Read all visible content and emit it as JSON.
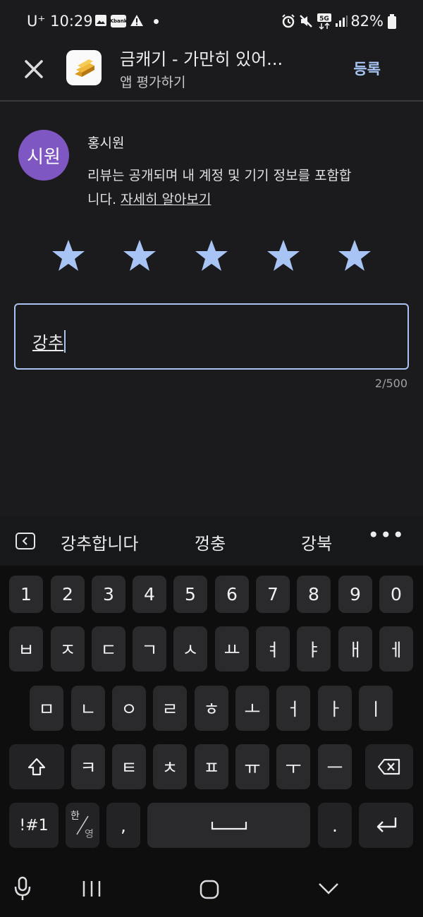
{
  "status": {
    "carrier": "U⁺ 10:29",
    "battery": "82%",
    "icons": [
      "gallery-icon",
      "kbank-icon",
      "warning-icon",
      "dot-icon",
      "alarm-icon",
      "mute-icon",
      "5g-icon",
      "signal-icon",
      "battery-icon"
    ],
    "kbank_label": "Kbank"
  },
  "header": {
    "app_title": "금캐기 - 가만히 있어...",
    "subtitle": "앱 평가하기",
    "post_label": "등록"
  },
  "user": {
    "avatar_text": "시원",
    "avatar_color": "#7e57c2",
    "name": "홍시원",
    "notice": "리뷰는 공개되며 내 계정 및 기기 정보를 포함합니다.",
    "learn_more": "자세히 알아보기"
  },
  "rating": {
    "value": 5,
    "max": 5,
    "star_color": "#a8c4f5"
  },
  "review": {
    "prefix": "강",
    "composing": "추",
    "counter": "2/500"
  },
  "suggestions": [
    "강추합니다",
    "껑충",
    "강북"
  ],
  "keyboard": {
    "row1": [
      "1",
      "2",
      "3",
      "4",
      "5",
      "6",
      "7",
      "8",
      "9",
      "0"
    ],
    "row2": [
      "ㅂ",
      "ㅈ",
      "ㄷ",
      "ㄱ",
      "ㅅ",
      "ㅛ",
      "ㅕ",
      "ㅑ",
      "ㅐ",
      "ㅔ"
    ],
    "row3": [
      "ㅁ",
      "ㄴ",
      "ㅇ",
      "ㄹ",
      "ㅎ",
      "ㅗ",
      "ㅓ",
      "ㅏ",
      "ㅣ"
    ],
    "row4": [
      "ㅋ",
      "ㅌ",
      "ㅊ",
      "ㅍ",
      "ㅠ",
      "ㅜ",
      "ㅡ"
    ],
    "symbols": "!#1",
    "lang_top": "한",
    "lang_bottom": "영",
    "comma": ",",
    "period": "."
  },
  "accent": "#a9c4f2"
}
